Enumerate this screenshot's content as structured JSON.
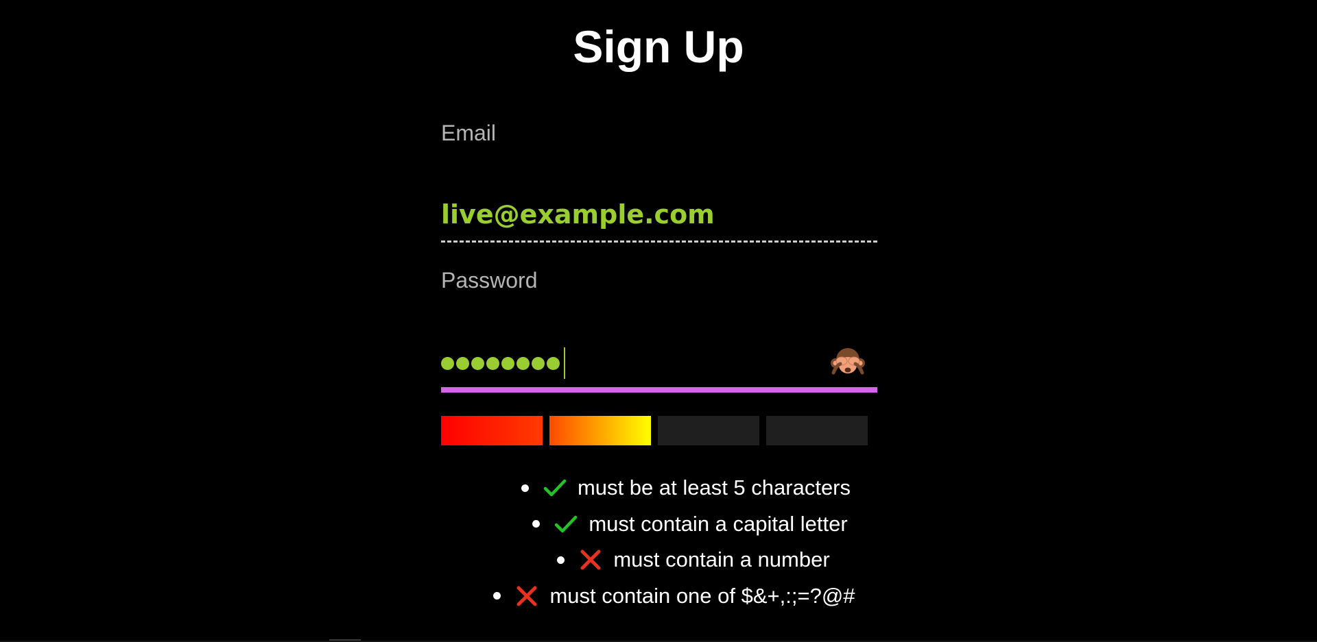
{
  "page": {
    "title": "Sign Up"
  },
  "form": {
    "email": {
      "label": "Email",
      "value": "live@example.com"
    },
    "password": {
      "label": "Password",
      "masked_length": 8,
      "visibility_toggle_icon": "see-no-evil-monkey-icon",
      "strength_level": 2,
      "strength_max": 4
    },
    "rules": [
      {
        "text": "must be at least 5 characters",
        "met": true,
        "icon": "check-icon"
      },
      {
        "text": "must contain a capital letter",
        "met": true,
        "icon": "check-icon"
      },
      {
        "text": "must contain a number",
        "met": false,
        "icon": "cross-icon"
      },
      {
        "text": "must contain one of $&+,:;=?@#",
        "met": false,
        "icon": "cross-icon"
      }
    ]
  },
  "colors": {
    "background": "#000000",
    "input_text": "#9acd32",
    "label": "#b5b5b5",
    "focus_underline": "#d464ec",
    "check": "#22c322",
    "cross": "#e8321e",
    "strength_empty": "#1f1f1f"
  }
}
